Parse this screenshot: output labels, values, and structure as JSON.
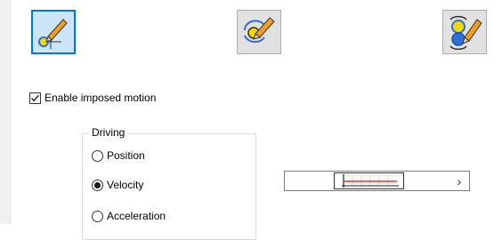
{
  "toolbar": {
    "buttons": [
      {
        "name": "define-joint-motion",
        "icon": "joint-pencil-icon",
        "state": "selected"
      },
      {
        "name": "rotation-motion",
        "icon": "rotation-pencil-icon",
        "state": "normal"
      },
      {
        "name": "coupled-motion",
        "icon": "coupled-joints-pencil-icon",
        "state": "normal"
      }
    ]
  },
  "options": {
    "enable_imposed_motion": {
      "label": "Enable imposed motion",
      "checked": true
    }
  },
  "driving": {
    "title": "Driving",
    "options": [
      {
        "label": "Position",
        "selected": false
      },
      {
        "label": "Velocity",
        "selected": true
      },
      {
        "label": "Acceleration",
        "selected": false
      }
    ]
  },
  "profile_selector": {
    "icon": "motion-profile-graph-icon",
    "next_icon": "chevron-right-icon",
    "next_glyph": "›"
  },
  "colors": {
    "accent": "#0078d7",
    "selected_fill": "#cce4f7",
    "joint_yellow": "#f5d800",
    "joint_blue": "#2f6fd6"
  }
}
